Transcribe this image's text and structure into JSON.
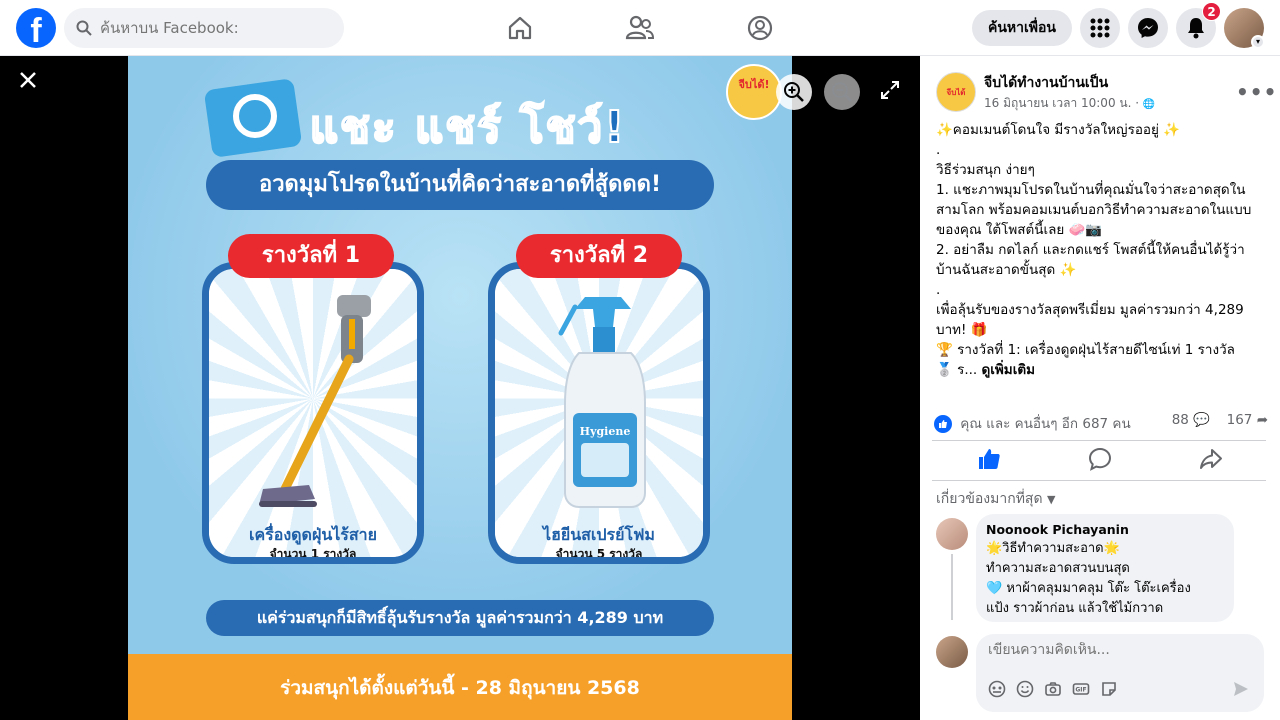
{
  "topbar": {
    "logo": "f",
    "search_placeholder": "ค้นหาบน Facebook:",
    "find_friends_label": "ค้นหาเพื่อน",
    "notification_count": "2"
  },
  "viewer": {
    "promo": {
      "headline": "แชะ แชร์ โชว์!",
      "subheadline": "อวดมุมโปรดในบ้านที่คิดว่าสะอาดที่สู้ดดด!",
      "badge_text": "จีบได้!",
      "prize1": {
        "label": "รางวัลที่ 1",
        "name": "เครื่องดูดฝุ่นไร้สาย",
        "qty": "จำนวน 1 รางวัล"
      },
      "prize2": {
        "label": "รางวัลที่ 2",
        "name": "ไฮยีนสเปรย์โฟม",
        "qty": "จำนวน 5 รางวัล",
        "brand": "Hygiene"
      },
      "value_text": "แค่ร่วมสนุกก็มีสิทธิ์ลุ้นรับรางวัล มูลค่ารวมกว่า 4,289 บาท",
      "footer_text": "ร่วมสนุกได้ตั้งแต่วันนี้ - 28 มิถุนายน 2568"
    }
  },
  "post": {
    "page_name": "จีบได้ทำงานบ้านเป็น",
    "page_avatar_text": "จีบได้",
    "time": "16 มิถุนายน เวลา 10:00 น. ·",
    "lines": [
      "✨คอมเมนต์โดนใจ มีรางวัลใหญ่รออยู่ ✨",
      ".",
      "วิธีร่วมสนุก ง่ายๆ",
      "1. แชะภาพมุมโปรดในบ้านที่คุณมั่นใจว่าสะอาดสุดในสามโลก พร้อมคอมเมนต์บอกวิธีทำความสะอาดในแบบของคุณ ใต้โพสต์นี้เลย 🧼📷",
      "2. อย่าลืม กดไลก์ และกดแชร์ โพสต์นี้ให้คนอื่นได้รู้ว่าบ้านฉันสะอาดขั้นสุด ✨",
      ".",
      "เพื่อลุ้นรับของรางวัลสุดพรีเมี่ยม มูลค่ารวมกว่า 4,289 บาท! 🎁",
      "🏆 รางวัลที่ 1: เครื่องดูดฝุ่นไร้สายดีไซน์เท่ 1 รางวัล"
    ],
    "truncated_line": "🥈 ร...",
    "see_more": "ดูเพิ่มเติม",
    "reactions_text": "คุณ และ คนอื่นๆ อีก 687 คน",
    "comment_count": "88",
    "share_count": "167",
    "relevance_label": "เกี่ยวข้องมากที่สุด",
    "comment": {
      "author": "Noonook Pichayanin",
      "lines": [
        "🌟วิธีทำความสะอาด🌟",
        "ทำความสะอาดสวนบนสุด",
        "🩵 หาผ้าคลุมมาคลุม โต๊ะ โต๊ะเครื่อง",
        "แป้ง ราวผ้าก่อน แล้วใช้ไม้กวาด"
      ]
    },
    "write_placeholder": "เขียนความคิดเห็น..."
  }
}
